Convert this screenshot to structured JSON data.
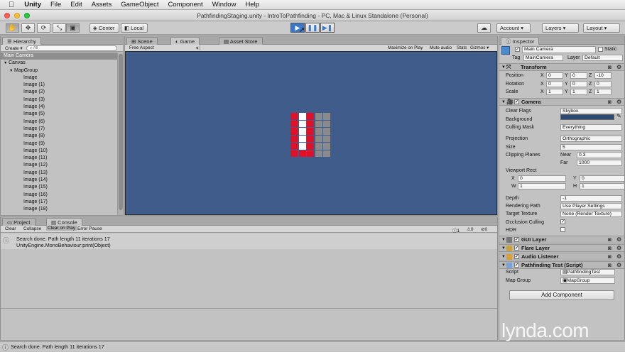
{
  "menubar": {
    "apple": "",
    "app": "Unity",
    "items": [
      "File",
      "Edit",
      "Assets",
      "GameObject",
      "Component",
      "Window",
      "Help"
    ]
  },
  "window": {
    "title": "PathfindingStaging.unity - IntroToPathfinding - PC, Mac & Linux Standalone (Personal)"
  },
  "toolbar": {
    "center": "Center",
    "local": "Local",
    "account": "Account",
    "layers": "Layers",
    "layout": "Layout"
  },
  "hierarchy": {
    "tab": "Hierarchy",
    "create": "Create",
    "search_placeholder": "All",
    "items": [
      {
        "label": "Main Camera",
        "indent": 0,
        "selected": true,
        "arrow": ""
      },
      {
        "label": "Canvas",
        "indent": 0,
        "selected": false,
        "arrow": "▼"
      },
      {
        "label": "MapGroup",
        "indent": 1,
        "selected": false,
        "arrow": "▼"
      },
      {
        "label": "Image",
        "indent": 2
      },
      {
        "label": "Image (1)",
        "indent": 2
      },
      {
        "label": "Image (2)",
        "indent": 2
      },
      {
        "label": "Image (3)",
        "indent": 2
      },
      {
        "label": "Image (4)",
        "indent": 2
      },
      {
        "label": "Image (5)",
        "indent": 2
      },
      {
        "label": "Image (6)",
        "indent": 2
      },
      {
        "label": "Image (7)",
        "indent": 2
      },
      {
        "label": "Image (8)",
        "indent": 2
      },
      {
        "label": "Image (9)",
        "indent": 2
      },
      {
        "label": "Image (10)",
        "indent": 2
      },
      {
        "label": "Image (11)",
        "indent": 2
      },
      {
        "label": "Image (12)",
        "indent": 2
      },
      {
        "label": "Image (13)",
        "indent": 2
      },
      {
        "label": "Image (14)",
        "indent": 2
      },
      {
        "label": "Image (15)",
        "indent": 2
      },
      {
        "label": "Image (16)",
        "indent": 2
      },
      {
        "label": "Image (17)",
        "indent": 2
      },
      {
        "label": "Image (18)",
        "indent": 2
      }
    ]
  },
  "views": {
    "tabs": [
      "Scene",
      "Game",
      "Asset Store"
    ],
    "aspect": "Free Aspect",
    "options": [
      "Maximize on Play",
      "Mute audio",
      "Stats",
      "Gizmos"
    ]
  },
  "grid": {
    "colors": {
      "red": "#e01028",
      "white": "#ffffff",
      "gray": "#8a8a8a"
    },
    "rows": [
      [
        "red",
        "white",
        "red",
        "gray",
        "gray"
      ],
      [
        "red",
        "white",
        "red",
        "gray",
        "gray"
      ],
      [
        "red",
        "white",
        "red",
        "gray",
        "gray"
      ],
      [
        "red",
        "white",
        "red",
        "gray",
        "gray"
      ],
      [
        "red",
        "white",
        "red",
        "gray",
        "gray"
      ],
      [
        "red",
        "red",
        "red",
        "gray",
        "gray"
      ]
    ]
  },
  "console": {
    "tabs": [
      "Project",
      "Console"
    ],
    "buttons": [
      "Clear",
      "Collapse",
      "Clear on Play",
      "Error Pause"
    ],
    "counts": [
      "1",
      "0",
      "0"
    ],
    "log_line1": "Search done. Path length 11 iterations 17",
    "log_line2": "UnityEngine.MonoBehaviour:print(Object)",
    "status": "Search done. Path length 11 iterations 17"
  },
  "inspector": {
    "tab": "Inspector",
    "name": "Main Camera",
    "static": "Static",
    "tag_label": "Tag",
    "tag": "MainCamera",
    "layer_label": "Layer",
    "layer": "Default",
    "transform": {
      "title": "Transform",
      "position": {
        "label": "Position",
        "x": "0",
        "y": "0",
        "z": "-10"
      },
      "rotation": {
        "label": "Rotation",
        "x": "0",
        "y": "0",
        "z": "0"
      },
      "scale": {
        "label": "Scale",
        "x": "1",
        "y": "1",
        "z": "1"
      }
    },
    "camera": {
      "title": "Camera",
      "clear_flags_label": "Clear Flags",
      "clear_flags": "Skybox",
      "background_label": "Background",
      "background_color": "#2d4a75",
      "culling_label": "Culling Mask",
      "culling": "Everything",
      "projection_label": "Projection",
      "projection": "Orthographic",
      "size_label": "Size",
      "size": "5",
      "clip_label": "Clipping Planes",
      "near_label": "Near",
      "near": "0.3",
      "far_label": "Far",
      "far": "1000",
      "viewport_label": "Viewport Rect",
      "vx": "0",
      "vy": "0",
      "vw": "1",
      "vh": "1",
      "depth_label": "Depth",
      "depth": "-1",
      "rendering_label": "Rendering Path",
      "rendering": "Use Player Settings",
      "target_label": "Target Texture",
      "target": "None (Render Texture)",
      "occlusion_label": "Occlusion Culling",
      "hdr_label": "HDR"
    },
    "components": [
      "GUI Layer",
      "Flare Layer",
      "Audio Listener",
      "Pathfinding Test (Script)"
    ],
    "script_label": "Script",
    "script": "PathfindingTest",
    "mapgroup_label": "Map Group",
    "mapgroup": "MapGroup",
    "add_component": "Add Component"
  },
  "watermark": "lynda.com"
}
